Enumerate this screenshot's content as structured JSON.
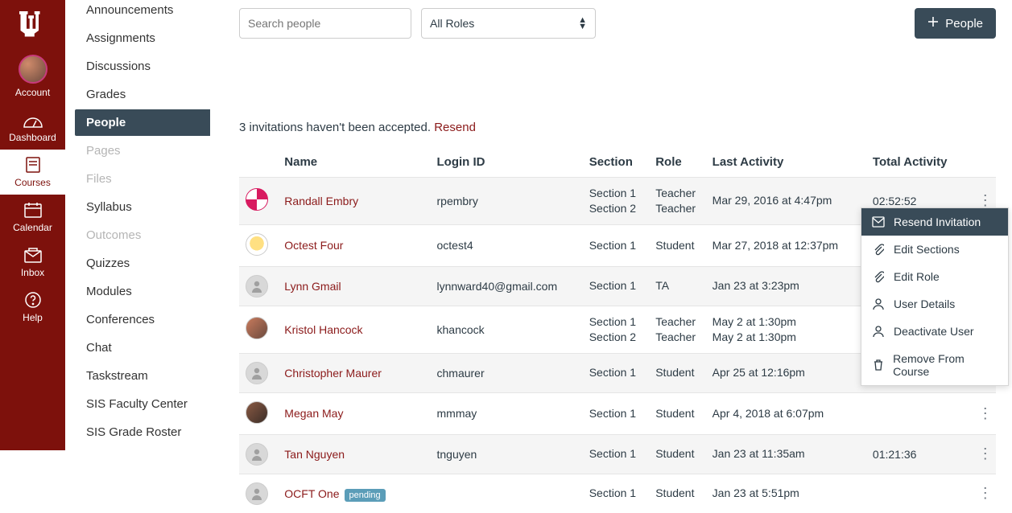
{
  "globalNav": {
    "items": [
      {
        "label": "Account"
      },
      {
        "label": "Dashboard"
      },
      {
        "label": "Courses"
      },
      {
        "label": "Calendar"
      },
      {
        "label": "Inbox"
      },
      {
        "label": "Help"
      }
    ]
  },
  "courseNav": {
    "items": [
      {
        "label": "Announcements",
        "truncated": true
      },
      {
        "label": "Assignments"
      },
      {
        "label": "Discussions"
      },
      {
        "label": "Grades"
      },
      {
        "label": "People",
        "active": true
      },
      {
        "label": "Pages",
        "disabled": true
      },
      {
        "label": "Files",
        "disabled": true
      },
      {
        "label": "Syllabus"
      },
      {
        "label": "Outcomes",
        "disabled": true
      },
      {
        "label": "Quizzes"
      },
      {
        "label": "Modules"
      },
      {
        "label": "Conferences"
      },
      {
        "label": "Chat"
      },
      {
        "label": "Taskstream"
      },
      {
        "label": "SIS Faculty Center"
      },
      {
        "label": "SIS Grade Roster"
      }
    ]
  },
  "toolbar": {
    "searchPlaceholder": "Search people",
    "roleFilter": "All Roles",
    "addPeople": "People"
  },
  "inviteMsg": {
    "text": "3 invitations haven't been accepted. ",
    "resend": "Resend"
  },
  "columns": {
    "name": "Name",
    "login": "Login ID",
    "section": "Section",
    "role": "Role",
    "last": "Last Activity",
    "total": "Total Activity"
  },
  "rows": [
    {
      "name": "Randall Embry",
      "login": "rpembry",
      "section": "Section 1\nSection 2",
      "role": "Teacher\nTeacher",
      "last": "Mar 29, 2016 at 4:47pm",
      "total": "02:52:52",
      "avatar": "magenta",
      "alt": true
    },
    {
      "name": "Octest Four",
      "login": "octest4",
      "section": "Section 1",
      "role": "Student",
      "last": "Mar 27, 2018 at 12:37pm",
      "total": "",
      "avatar": "yellow"
    },
    {
      "name": "Lynn Gmail",
      "login": "lynnward40@gmail.com",
      "section": "Section 1",
      "role": "TA",
      "last": "Jan 23 at 3:23pm",
      "total": "",
      "avatar": "gray",
      "alt": true
    },
    {
      "name": "Kristol Hancock",
      "login": "khancock",
      "section": "Section 1\nSection 2",
      "role": "Teacher\nTeacher",
      "last": "May 2 at 1:30pm\nMay 2 at 1:30pm",
      "total": "",
      "avatar": "photo1"
    },
    {
      "name": "Christopher Maurer",
      "login": "chmaurer",
      "section": "Section 1",
      "role": "Student",
      "last": "Apr 25 at 12:16pm",
      "total": "",
      "avatar": "gray",
      "alt": true
    },
    {
      "name": "Megan May",
      "login": "mmmay",
      "section": "Section 1",
      "role": "Student",
      "last": "Apr 4, 2018 at 6:07pm",
      "total": "",
      "avatar": "photo2"
    },
    {
      "name": "Tan Nguyen",
      "login": "tnguyen",
      "section": "Section 1",
      "role": "Student",
      "last": "Jan 23 at 11:35am",
      "total": "01:21:36",
      "avatar": "gray",
      "alt": true
    },
    {
      "name": "OCFT One",
      "login": "",
      "section": "Section 1",
      "role": "Student",
      "last": "Jan 23 at 5:51pm",
      "total": "",
      "avatar": "gray",
      "pending": "pending"
    }
  ],
  "dropdown": {
    "items": [
      {
        "label": "Resend Invitation",
        "active": true,
        "icon": "mail"
      },
      {
        "label": "Edit Sections",
        "icon": "clip"
      },
      {
        "label": "Edit Role",
        "icon": "clip"
      },
      {
        "label": "User Details",
        "icon": "user"
      },
      {
        "label": "Deactivate User",
        "icon": "user"
      },
      {
        "label": "Remove From Course",
        "icon": "trash"
      }
    ]
  }
}
